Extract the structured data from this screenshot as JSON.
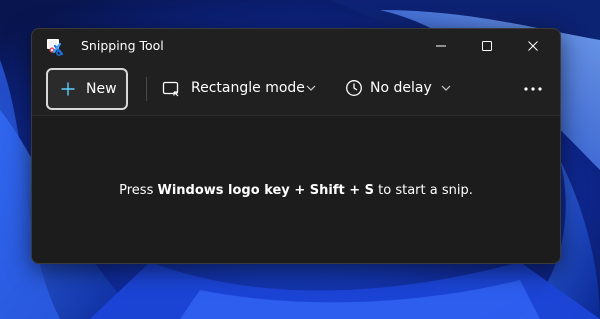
{
  "window": {
    "title": "Snipping Tool",
    "app_icon": "snipping-tool-icon",
    "controls": {
      "minimize_icon": "minimize-icon",
      "maximize_icon": "maximize-icon",
      "close_icon": "close-icon"
    }
  },
  "toolbar": {
    "new_label": "New",
    "new_icon": "plus-icon",
    "mode_label": "Rectangle mode",
    "mode_icon": "rectangle-icon",
    "delay_label": "No delay",
    "delay_icon": "clock-icon",
    "more_icon": "more-icon"
  },
  "hint": {
    "prefix": "Press ",
    "key1": "Windows logo key",
    "plus1": " + ",
    "key2": "Shift",
    "plus2": " + ",
    "key3": "S",
    "suffix": " to start a snip."
  },
  "colors": {
    "window_bg": "#202020",
    "content_bg": "#1c1c1c",
    "accent": "#60cdff",
    "wallpaper": "#1a3fd1"
  }
}
